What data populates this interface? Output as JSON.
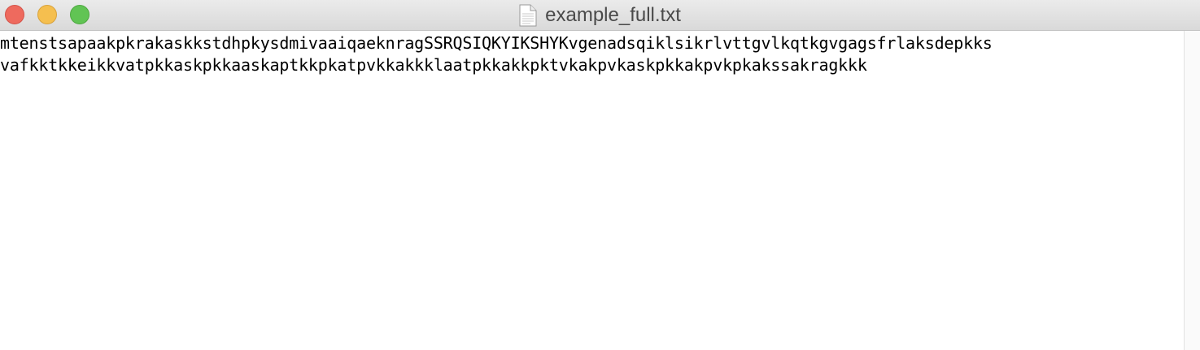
{
  "window": {
    "title": "example_full.txt",
    "title_icon": "text-document-icon",
    "controls": {
      "close_color": "#ee6a5e",
      "minimize_color": "#f5bf4f",
      "zoom_color": "#61c454"
    }
  },
  "document": {
    "lines": [
      "mtenstsapaakpkrakaskkstdhpkysdmivaaiqaeknragSSRQSIQKYIKSHYKvgenadsqiklsikrlvttgvlkqtkgvgagsfrlaksdepkks",
      "vafkktkkeikkvatpkkaskpkkaaskaptkkpkatpvkkakkklaatpkkakkpktvkakpvkaskpkkakpvkpkakssakragkkk"
    ]
  }
}
